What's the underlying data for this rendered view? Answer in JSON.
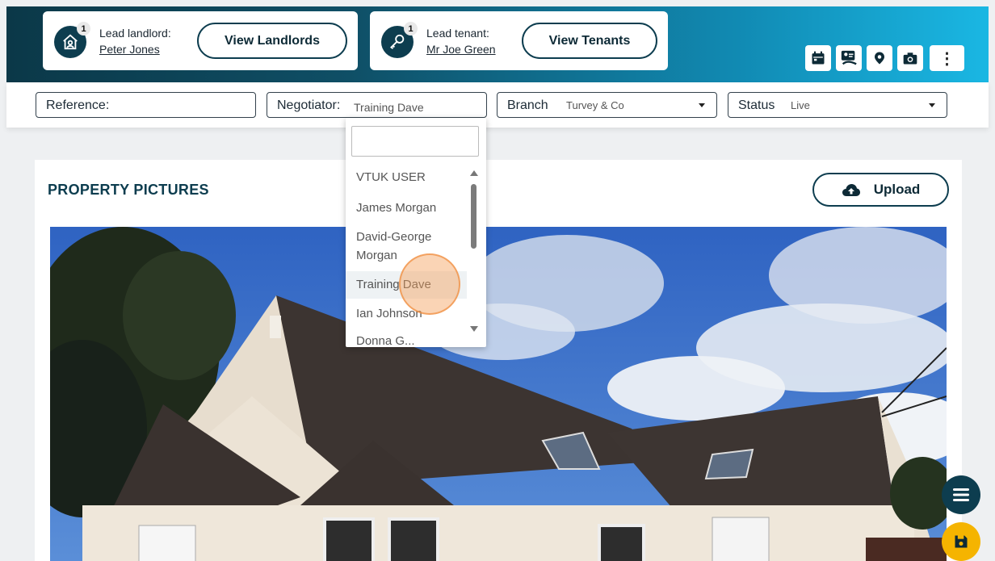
{
  "header": {
    "landlord": {
      "count": "1",
      "label": "Lead landlord:",
      "name": "Peter Jones",
      "button": "View Landlords"
    },
    "tenant": {
      "count": "1",
      "label": "Lead tenant:",
      "name": "Mr Joe Green",
      "button": "View Tenants"
    },
    "icons": [
      "calendar-icon",
      "id-card-icon",
      "map-pin-icon",
      "camera-icon",
      "more-vertical-icon"
    ],
    "more_glyph": "⋮"
  },
  "filters": {
    "reference": {
      "label": "Reference:",
      "value": ""
    },
    "negotiator": {
      "label": "Negotiator:",
      "value": "Training Dave"
    },
    "branch": {
      "label": "Branch",
      "value": "Turvey & Co"
    },
    "status": {
      "label": "Status",
      "value": "Live"
    }
  },
  "dropdown": {
    "search_value": "",
    "items": [
      "VTUK USER",
      "James Morgan",
      "David-George Morgan",
      "Training Dave",
      "Ian Johnson",
      "Donna G..."
    ],
    "highlighted": "Training Dave"
  },
  "panel": {
    "title": "PROPERTY PICTURES",
    "upload_label": "Upload"
  },
  "colors": {
    "brand_dark": "#0d3d4f",
    "brand_light": "#1ab7e3",
    "save_fab": "#f5b400"
  }
}
